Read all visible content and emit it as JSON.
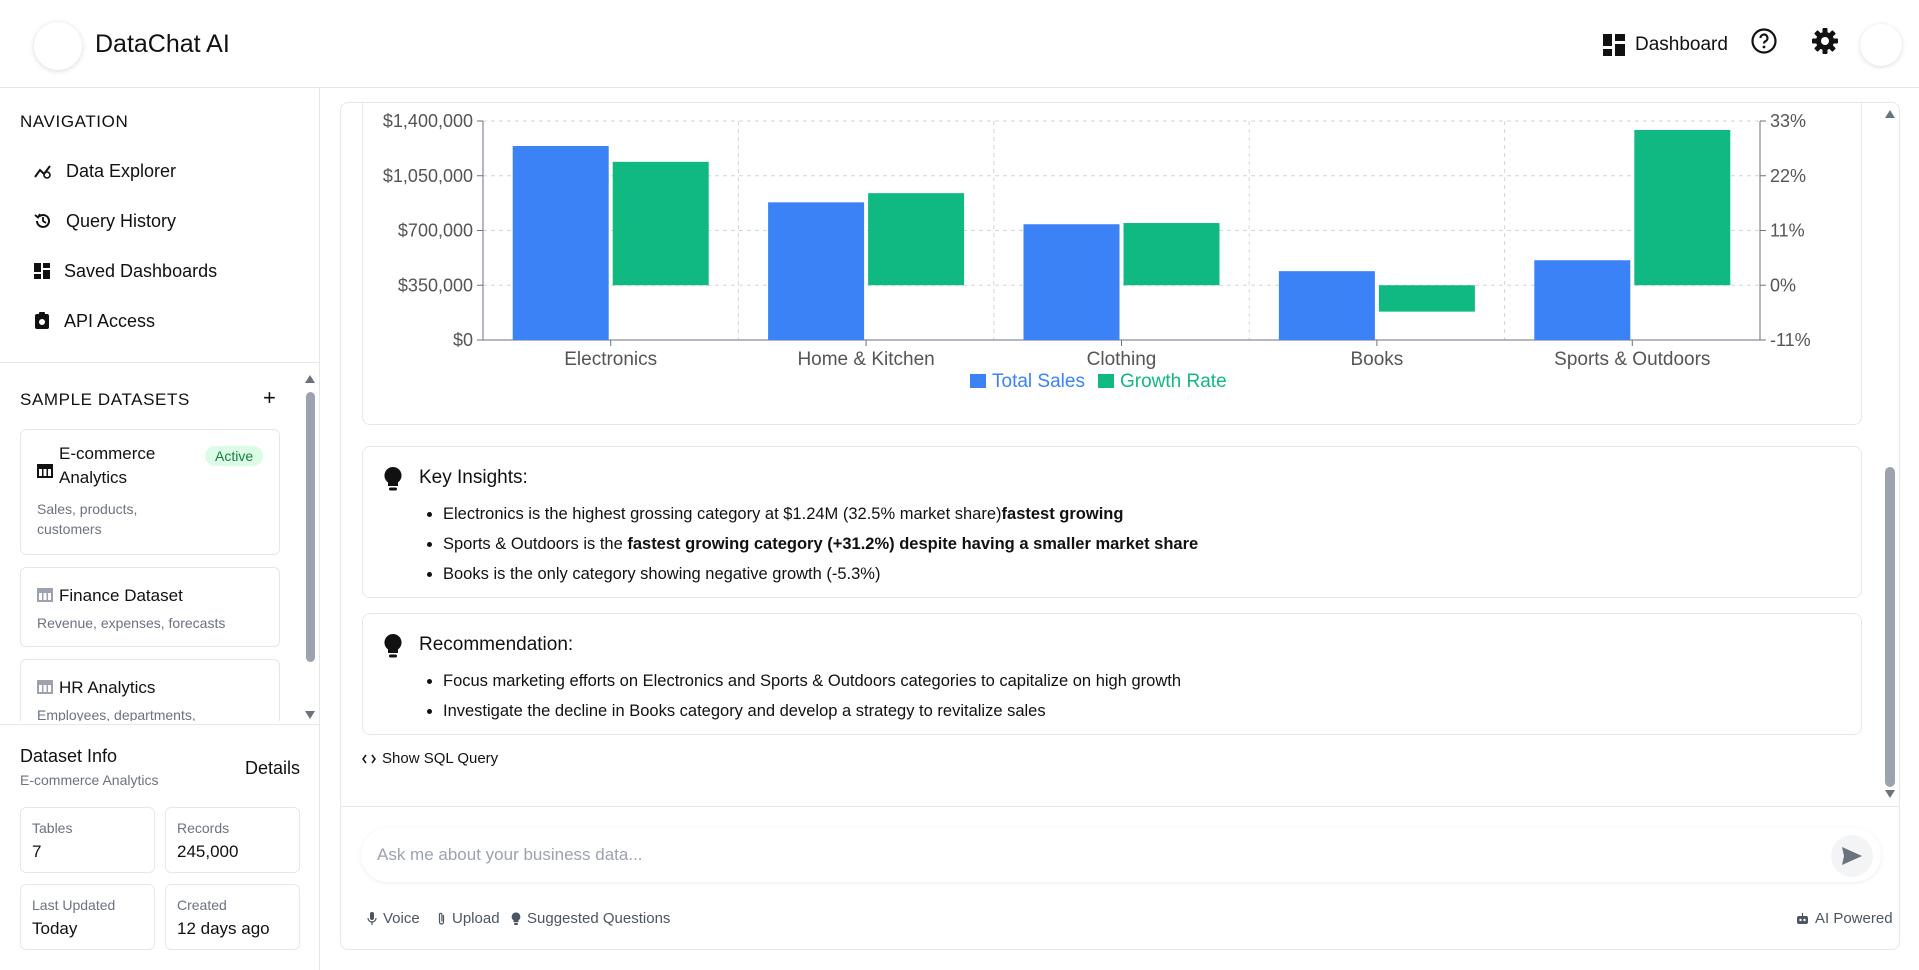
{
  "header": {
    "app_title": "DataChat AI",
    "dashboard_label": "Dashboard"
  },
  "sidebar": {
    "nav_title": "NAVIGATION",
    "nav_items": [
      {
        "label": "Data Explorer",
        "icon": "chart-icon"
      },
      {
        "label": "Query History",
        "icon": "history-icon"
      },
      {
        "label": "Saved Dashboards",
        "icon": "dashboard-icon"
      },
      {
        "label": "API Access",
        "icon": "api-icon"
      }
    ],
    "datasets_title": "SAMPLE DATASETS",
    "add_symbol": "+",
    "datasets": [
      {
        "name": "E-commerce Analytics",
        "description": "Sales, products, customers",
        "badge": "Active"
      },
      {
        "name": "Finance Dataset",
        "description": "Revenue, expenses, forecasts"
      },
      {
        "name": "HR Analytics",
        "description": "Employees, departments,"
      }
    ],
    "info": {
      "title": "Dataset Info",
      "subtitle": "E-commerce Analytics",
      "details_label": "Details",
      "stats": [
        {
          "label": "Tables",
          "value": "7"
        },
        {
          "label": "Records",
          "value": "245,000"
        },
        {
          "label": "Last Updated",
          "value": "Today"
        },
        {
          "label": "Created",
          "value": "12 days ago"
        }
      ]
    }
  },
  "chart_data": {
    "type": "bar",
    "categories": [
      "Electronics",
      "Home & Kitchen",
      "Clothing",
      "Books",
      "Sports & Outdoors"
    ],
    "series": [
      {
        "name": "Total Sales",
        "axis": "left",
        "color": "#3b82f6",
        "values": [
          1240000,
          880000,
          740000,
          440000,
          510000
        ]
      },
      {
        "name": "Growth Rate",
        "axis": "right",
        "color": "#10b981",
        "values": [
          24.8,
          18.5,
          12.5,
          -5.3,
          31.2
        ]
      }
    ],
    "y_left": {
      "min": 0,
      "max": 1400000,
      "ticks": [
        "$0",
        "$350,000",
        "$700,000",
        "$1,050,000",
        "$1,400,000"
      ]
    },
    "y_right": {
      "min": -11,
      "max": 33,
      "ticks": [
        "-11%",
        "0%",
        "11%",
        "22%",
        "33%"
      ]
    },
    "grid": true,
    "legend": "bottom-center"
  },
  "insights": {
    "title": "Key Insights:",
    "items": [
      {
        "text": "Electronics is the highest grossing category at $1.24M (32.5% market share)",
        "bold": "fastest growing"
      },
      {
        "text": "Sports & Outdoors is the ",
        "bold": "fastest growing category (+31.2%) despite having a smaller market share"
      },
      {
        "text": "Books is the only category showing negative growth (-5.3%)",
        "bold": ""
      }
    ]
  },
  "recommendation": {
    "title": "Recommendation:",
    "items": [
      "Focus marketing efforts on Electronics and Sports & Outdoors categories to capitalize on high growth",
      "Investigate the decline in Books category and develop a strategy to revitalize sales"
    ]
  },
  "sql_toggle_label": "Show SQL Query",
  "input": {
    "placeholder": "Ask me about your business data...",
    "value": ""
  },
  "toolbar": {
    "voice": "Voice",
    "upload": "Upload",
    "suggested": "Suggested Questions",
    "ai": "AI Powered"
  },
  "colors": {
    "accent_blue": "#3b82f6",
    "accent_green": "#10b981"
  }
}
